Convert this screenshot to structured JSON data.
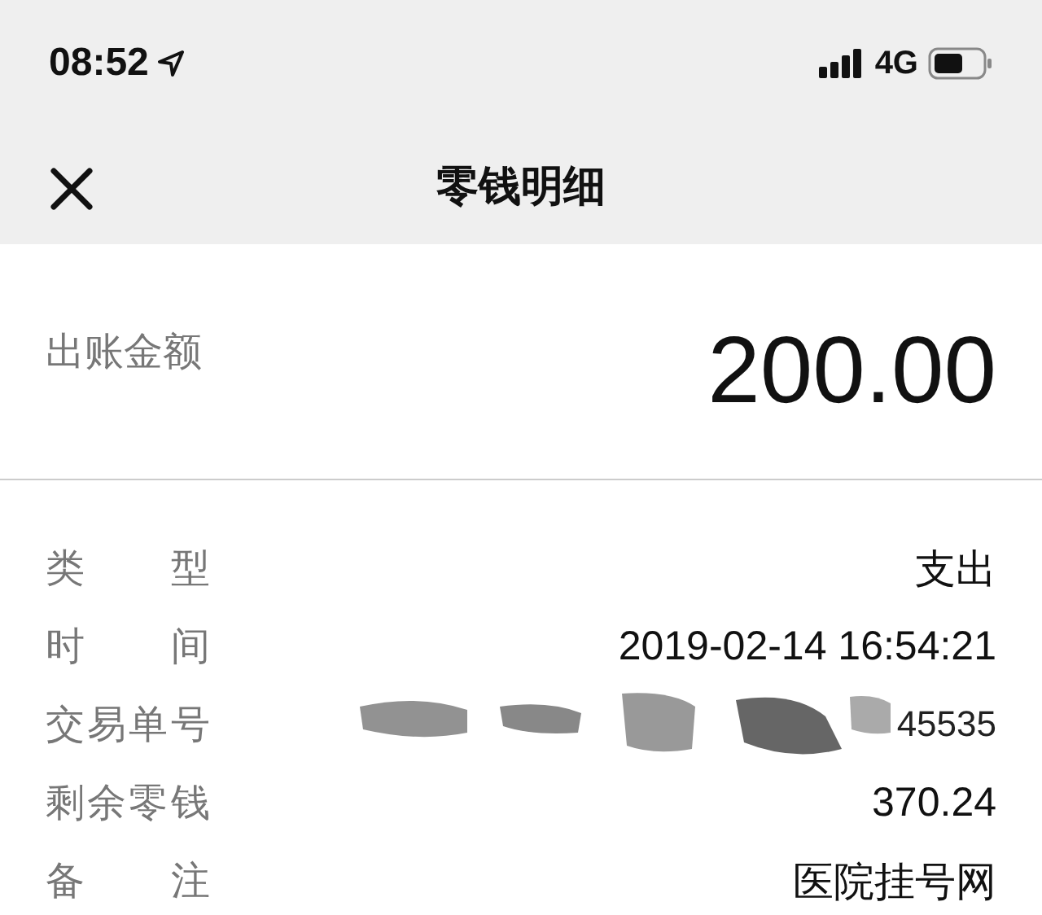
{
  "status_bar": {
    "time": "08:52",
    "network": "4G"
  },
  "nav": {
    "title": "零钱明细"
  },
  "amount": {
    "label": "出账金额",
    "value": "200.00"
  },
  "details": [
    {
      "label": "类型",
      "value": "支出",
      "redacted": false
    },
    {
      "label": "时间",
      "value": "2019-02-14 16:54:21",
      "redacted": false
    },
    {
      "label": "交易单号",
      "value": "45535",
      "redacted": true
    },
    {
      "label": "剩余零钱",
      "value": "370.24",
      "redacted": false
    },
    {
      "label": "备注",
      "value": "医院挂号网",
      "redacted": false
    }
  ]
}
